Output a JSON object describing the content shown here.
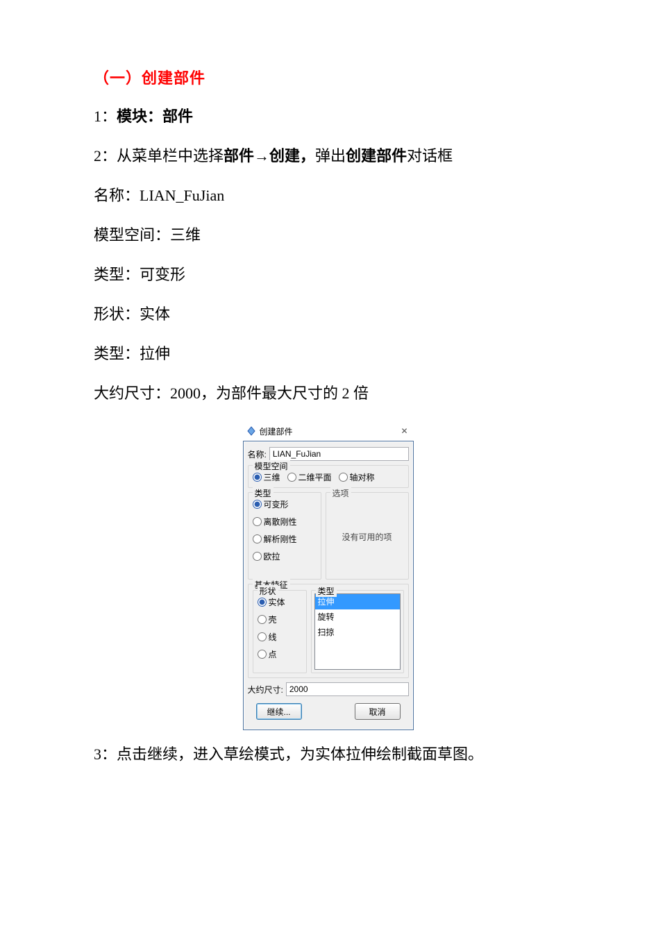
{
  "heading": "（一）创建部件",
  "p1_prefix": "1：",
  "p1_label": "模块：部件",
  "p2_prefix": "2：",
  "p2_a": "从菜单栏中选择",
  "p2_b": "部件→创建，",
  "p2_c": "弹出",
  "p2_d": "创建部件",
  "p2_e": "对话框",
  "p3": "名称：LIAN_FuJian",
  "p4": "模型空间：三维",
  "p5": "类型：可变形",
  "p6": "形状：实体",
  "p7": "类型：拉伸",
  "p8_a": "大约尺寸：",
  "p8_b": "2000",
  "p8_c": "，为部件最大尺寸的 2 倍",
  "step3": "3：点击继续，进入草绘模式，为实体拉伸绘制截面草图。",
  "dialog": {
    "title": "创建部件",
    "close": "✕",
    "name_label": "名称:",
    "name_value": "LIAN_FuJian",
    "modelspace_legend": "模型空间",
    "ms_opts": [
      "三维",
      "二维平面",
      "轴对称"
    ],
    "type_legend": "类型",
    "type_opts": [
      "可变形",
      "离散刚性",
      "解析刚性",
      "欧拉"
    ],
    "options_legend": "选项",
    "options_text": "没有可用的项",
    "basefeat_legend": "基本特征",
    "shape_legend": "形状",
    "shape_opts": [
      "实体",
      "壳",
      "线",
      "点"
    ],
    "type2_legend": "类型",
    "type2_items": [
      "拉伸",
      "旋转",
      "扫掠"
    ],
    "size_label": "大约尺寸:",
    "size_value": "2000",
    "btn_continue": "继续...",
    "btn_cancel": "取消"
  }
}
